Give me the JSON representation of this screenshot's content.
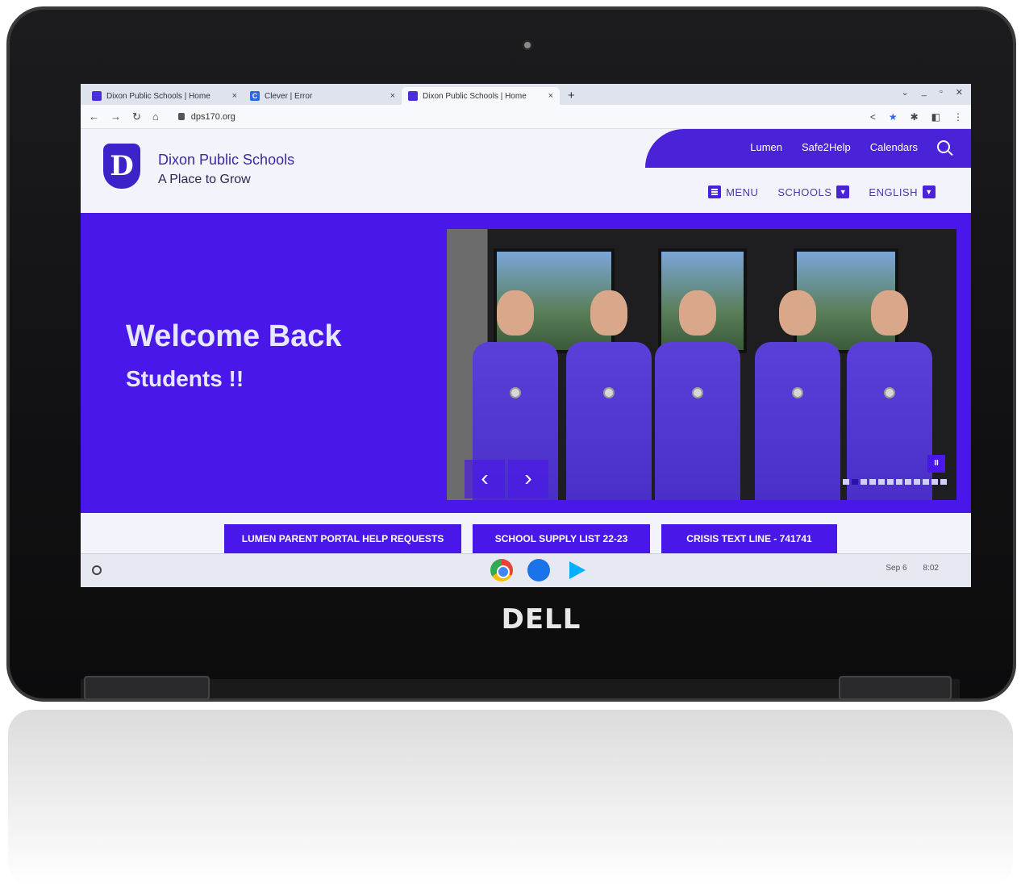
{
  "device": {
    "brand": "DELL"
  },
  "browser": {
    "tabs": [
      {
        "title": "Dixon Public Schools | Home",
        "favicon": "school-logo"
      },
      {
        "title": "Clever | Error",
        "favicon": "clever-logo",
        "favicon_letter": "C"
      },
      {
        "title": "Dixon Public Schools | Home",
        "favicon": "school-logo",
        "active": true
      }
    ],
    "new_tab": "+",
    "close_glyph": "×",
    "url": "dps170.org"
  },
  "site": {
    "logo_letter": "D",
    "name": "Dixon Public Schools",
    "tagline": "A Place to Grow",
    "quick_links": [
      "Lumen",
      "Safe2Help",
      "Calendars"
    ],
    "nav": {
      "menu": "MENU",
      "schools": "SCHOOLS",
      "language": "ENGLISH"
    },
    "accent_color": "#4a17ea"
  },
  "hero": {
    "title": "Welcome Back",
    "subtitle": "Students !!",
    "prev": "‹",
    "next": "›",
    "pause": "II",
    "slide_count": 12,
    "active_slide": 1
  },
  "quick_buttons": [
    "LUMEN PARENT PORTAL HELP REQUESTS",
    "SCHOOL SUPPLY LIST 22-23",
    "CRISIS TEXT LINE - 741741"
  ],
  "shelf": {
    "date": "Sep 6",
    "time": "8:02"
  }
}
